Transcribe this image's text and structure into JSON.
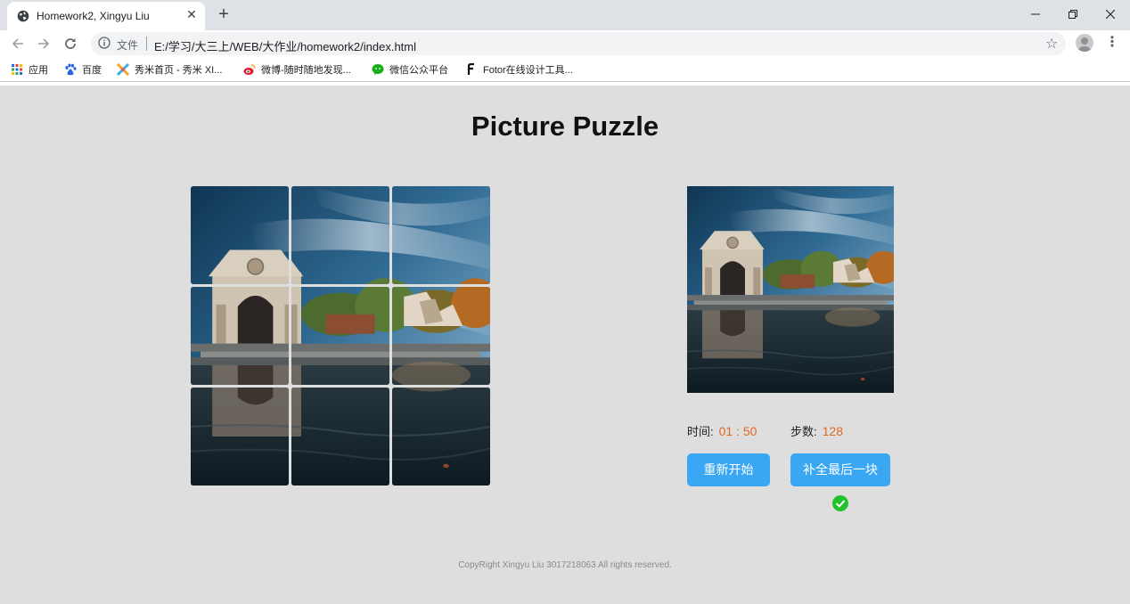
{
  "browser": {
    "tab_title": "Homework2, Xingyu Liu",
    "tab_close": "✕",
    "new_tab": "+",
    "file_label": "文件",
    "url": "E:/学习/大三上/WEB/大作业/homework2/index.html",
    "bookmarks": [
      {
        "label": "应用",
        "icon": "apps-icon"
      },
      {
        "label": "百度",
        "icon": "baidu-paw-icon"
      },
      {
        "label": "秀米首页 - 秀米 XI...",
        "icon": "xiumi-icon"
      },
      {
        "label": "微博-随时随地发现...",
        "icon": "weibo-icon"
      },
      {
        "label": "微信公众平台",
        "icon": "wechat-icon"
      },
      {
        "label": "Fotor在线设计工具...",
        "icon": "fotor-icon"
      }
    ]
  },
  "page": {
    "title": "Picture Puzzle",
    "time_label": "时间:",
    "time_value": "01 : 50",
    "steps_label": "步数:",
    "steps_value": "128",
    "restart_button": "重新开始",
    "complete_button": "补全最后一块",
    "footer": "CopyRight Xingyu Liu 3017218063 All rights reserved."
  },
  "colors": {
    "accent": "#3aa7f5",
    "value_orange": "#e26a1f",
    "success_green": "#22c22e",
    "page_bg": "#dedede"
  }
}
